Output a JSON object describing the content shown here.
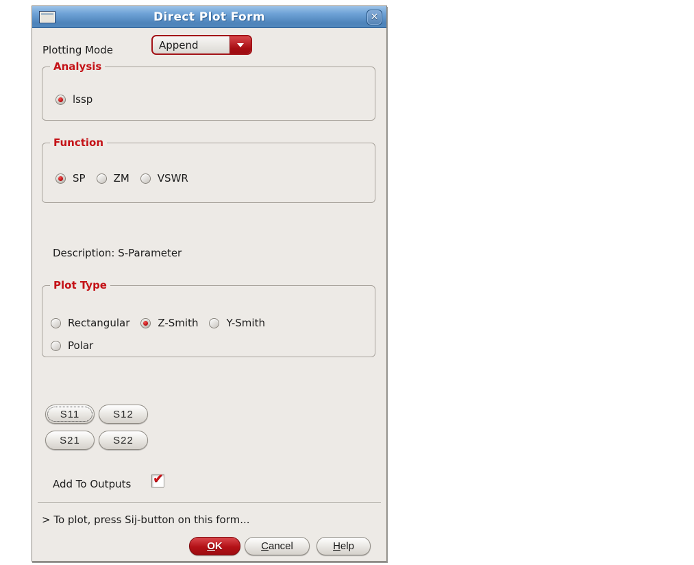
{
  "window": {
    "title": "Direct Plot Form",
    "close_glyph": "✕"
  },
  "plotting_mode": {
    "label": "Plotting Mode",
    "value": "Append"
  },
  "analysis": {
    "legend": "Analysis",
    "options": [
      {
        "label": "lssp",
        "selected": true
      }
    ]
  },
  "function_group": {
    "legend": "Function",
    "options": [
      {
        "label": "SP",
        "selected": true
      },
      {
        "label": "ZM",
        "selected": false
      },
      {
        "label": "VSWR",
        "selected": false
      }
    ]
  },
  "description": {
    "text": "Description: S-Parameter"
  },
  "plot_type": {
    "legend": "Plot Type",
    "options": [
      {
        "label": "Rectangular",
        "selected": false
      },
      {
        "label": "Z-Smith",
        "selected": true
      },
      {
        "label": "Y-Smith",
        "selected": false
      },
      {
        "label": "Polar",
        "selected": false
      }
    ]
  },
  "s_parameters": {
    "buttons": [
      {
        "label": "S11",
        "focused": true
      },
      {
        "label": "S12",
        "focused": false
      },
      {
        "label": "S21",
        "focused": false
      },
      {
        "label": "S22",
        "focused": false
      }
    ]
  },
  "add_to_outputs": {
    "label": "Add To Outputs",
    "checked": true,
    "check_glyph": "✔"
  },
  "status": {
    "message": "> To plot, press Sij-button on this form..."
  },
  "footer": {
    "ok_label": "OK",
    "cancel_label": "Cancel",
    "help_label": "Help"
  },
  "colors": {
    "accent_red": "#b5121b",
    "titlebar_blue": "#5b92c8",
    "dialog_bg": "#edeae6"
  }
}
